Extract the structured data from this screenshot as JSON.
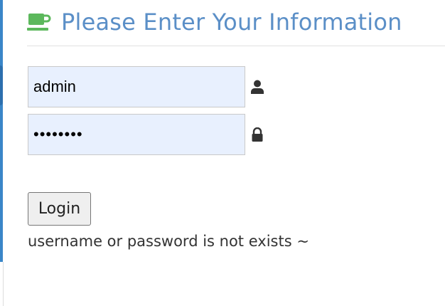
{
  "header": {
    "icon": "coffee-cup-icon",
    "title": "Please Enter Your Information",
    "title_color": "#5b8fc7",
    "icon_color": "#5cb85c"
  },
  "form": {
    "username": {
      "value": "admin",
      "icon": "user-icon"
    },
    "password": {
      "value": "••••••••",
      "icon": "lock-icon"
    },
    "submit_label": "Login"
  },
  "status": {
    "message": "username or password is not exists ~"
  },
  "colors": {
    "field_bg": "#e8f0fe",
    "accent": "#3a86c8"
  }
}
